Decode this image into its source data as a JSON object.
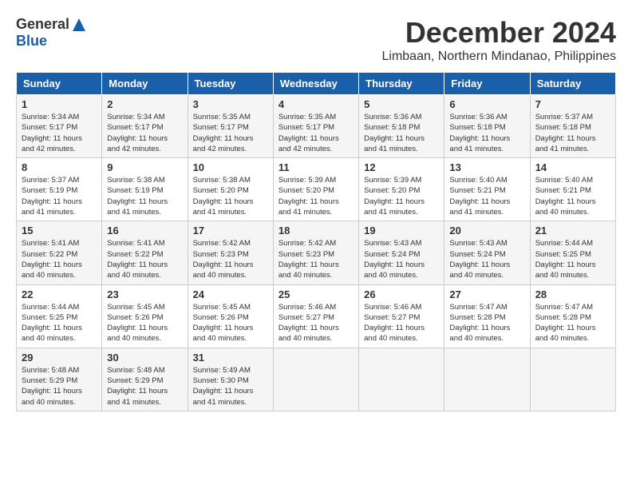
{
  "header": {
    "logo_general": "General",
    "logo_blue": "Blue",
    "month_title": "December 2024",
    "location": "Limbaan, Northern Mindanao, Philippines"
  },
  "calendar": {
    "days_of_week": [
      "Sunday",
      "Monday",
      "Tuesday",
      "Wednesday",
      "Thursday",
      "Friday",
      "Saturday"
    ],
    "weeks": [
      [
        null,
        null,
        null,
        null,
        null,
        null,
        null
      ]
    ],
    "cells": [
      {
        "day": null,
        "info": null
      },
      {
        "day": null,
        "info": null
      },
      {
        "day": null,
        "info": null
      },
      {
        "day": null,
        "info": null
      },
      {
        "day": null,
        "info": null
      },
      {
        "day": null,
        "info": null
      },
      {
        "day": null,
        "info": null
      }
    ]
  },
  "days": [
    {
      "num": "1",
      "sunrise": "5:34 AM",
      "sunset": "5:17 PM",
      "daylight": "11 hours and 42 minutes."
    },
    {
      "num": "2",
      "sunrise": "5:34 AM",
      "sunset": "5:17 PM",
      "daylight": "11 hours and 42 minutes."
    },
    {
      "num": "3",
      "sunrise": "5:35 AM",
      "sunset": "5:17 PM",
      "daylight": "11 hours and 42 minutes."
    },
    {
      "num": "4",
      "sunrise": "5:35 AM",
      "sunset": "5:17 PM",
      "daylight": "11 hours and 42 minutes."
    },
    {
      "num": "5",
      "sunrise": "5:36 AM",
      "sunset": "5:18 PM",
      "daylight": "11 hours and 41 minutes."
    },
    {
      "num": "6",
      "sunrise": "5:36 AM",
      "sunset": "5:18 PM",
      "daylight": "11 hours and 41 minutes."
    },
    {
      "num": "7",
      "sunrise": "5:37 AM",
      "sunset": "5:18 PM",
      "daylight": "11 hours and 41 minutes."
    },
    {
      "num": "8",
      "sunrise": "5:37 AM",
      "sunset": "5:19 PM",
      "daylight": "11 hours and 41 minutes."
    },
    {
      "num": "9",
      "sunrise": "5:38 AM",
      "sunset": "5:19 PM",
      "daylight": "11 hours and 41 minutes."
    },
    {
      "num": "10",
      "sunrise": "5:38 AM",
      "sunset": "5:20 PM",
      "daylight": "11 hours and 41 minutes."
    },
    {
      "num": "11",
      "sunrise": "5:39 AM",
      "sunset": "5:20 PM",
      "daylight": "11 hours and 41 minutes."
    },
    {
      "num": "12",
      "sunrise": "5:39 AM",
      "sunset": "5:20 PM",
      "daylight": "11 hours and 41 minutes."
    },
    {
      "num": "13",
      "sunrise": "5:40 AM",
      "sunset": "5:21 PM",
      "daylight": "11 hours and 41 minutes."
    },
    {
      "num": "14",
      "sunrise": "5:40 AM",
      "sunset": "5:21 PM",
      "daylight": "11 hours and 40 minutes."
    },
    {
      "num": "15",
      "sunrise": "5:41 AM",
      "sunset": "5:22 PM",
      "daylight": "11 hours and 40 minutes."
    },
    {
      "num": "16",
      "sunrise": "5:41 AM",
      "sunset": "5:22 PM",
      "daylight": "11 hours and 40 minutes."
    },
    {
      "num": "17",
      "sunrise": "5:42 AM",
      "sunset": "5:23 PM",
      "daylight": "11 hours and 40 minutes."
    },
    {
      "num": "18",
      "sunrise": "5:42 AM",
      "sunset": "5:23 PM",
      "daylight": "11 hours and 40 minutes."
    },
    {
      "num": "19",
      "sunrise": "5:43 AM",
      "sunset": "5:24 PM",
      "daylight": "11 hours and 40 minutes."
    },
    {
      "num": "20",
      "sunrise": "5:43 AM",
      "sunset": "5:24 PM",
      "daylight": "11 hours and 40 minutes."
    },
    {
      "num": "21",
      "sunrise": "5:44 AM",
      "sunset": "5:25 PM",
      "daylight": "11 hours and 40 minutes."
    },
    {
      "num": "22",
      "sunrise": "5:44 AM",
      "sunset": "5:25 PM",
      "daylight": "11 hours and 40 minutes."
    },
    {
      "num": "23",
      "sunrise": "5:45 AM",
      "sunset": "5:26 PM",
      "daylight": "11 hours and 40 minutes."
    },
    {
      "num": "24",
      "sunrise": "5:45 AM",
      "sunset": "5:26 PM",
      "daylight": "11 hours and 40 minutes."
    },
    {
      "num": "25",
      "sunrise": "5:46 AM",
      "sunset": "5:27 PM",
      "daylight": "11 hours and 40 minutes."
    },
    {
      "num": "26",
      "sunrise": "5:46 AM",
      "sunset": "5:27 PM",
      "daylight": "11 hours and 40 minutes."
    },
    {
      "num": "27",
      "sunrise": "5:47 AM",
      "sunset": "5:28 PM",
      "daylight": "11 hours and 40 minutes."
    },
    {
      "num": "28",
      "sunrise": "5:47 AM",
      "sunset": "5:28 PM",
      "daylight": "11 hours and 40 minutes."
    },
    {
      "num": "29",
      "sunrise": "5:48 AM",
      "sunset": "5:29 PM",
      "daylight": "11 hours and 40 minutes."
    },
    {
      "num": "30",
      "sunrise": "5:48 AM",
      "sunset": "5:29 PM",
      "daylight": "11 hours and 41 minutes."
    },
    {
      "num": "31",
      "sunrise": "5:49 AM",
      "sunset": "5:30 PM",
      "daylight": "11 hours and 41 minutes."
    }
  ]
}
